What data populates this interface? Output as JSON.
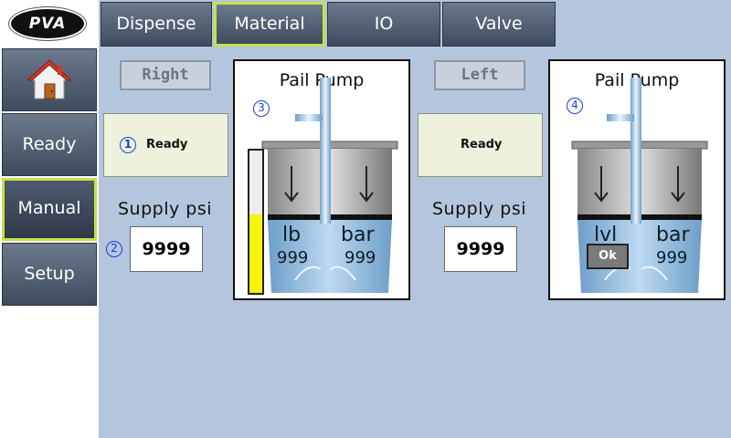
{
  "brand": {
    "logo_text": "PVA"
  },
  "sidebar": {
    "items": [
      {
        "label": "Ready"
      },
      {
        "label": "Manual"
      },
      {
        "label": "Setup"
      }
    ]
  },
  "tabs": [
    {
      "label": "Dispense"
    },
    {
      "label": "Material"
    },
    {
      "label": "IO"
    },
    {
      "label": "Valve"
    }
  ],
  "right": {
    "side_label": "Right",
    "status_marker": "1",
    "status": "Ready",
    "supply_marker": "2",
    "supply_label": "Supply psi",
    "supply_value": "9999",
    "pump": {
      "marker": "3",
      "title": "Pail Pump",
      "left_unit": "lb",
      "left_value": "999",
      "right_unit": "bar",
      "right_value": "999",
      "level_fraction": 0.55
    }
  },
  "left": {
    "side_label": "Left",
    "status": "Ready",
    "supply_label": "Supply psi",
    "supply_value": "9999",
    "pump": {
      "marker": "4",
      "title": "Pail Pump",
      "left_unit": "lvl",
      "ok_label": "Ok",
      "right_unit": "bar",
      "right_value": "999"
    }
  },
  "colors": {
    "background": "#b4c6dd",
    "accent_border": "#c6e04a",
    "marker_blue": "#1a3ed6",
    "level_yellow": "#f8f20c"
  },
  "icons": {
    "home": "home-icon"
  }
}
